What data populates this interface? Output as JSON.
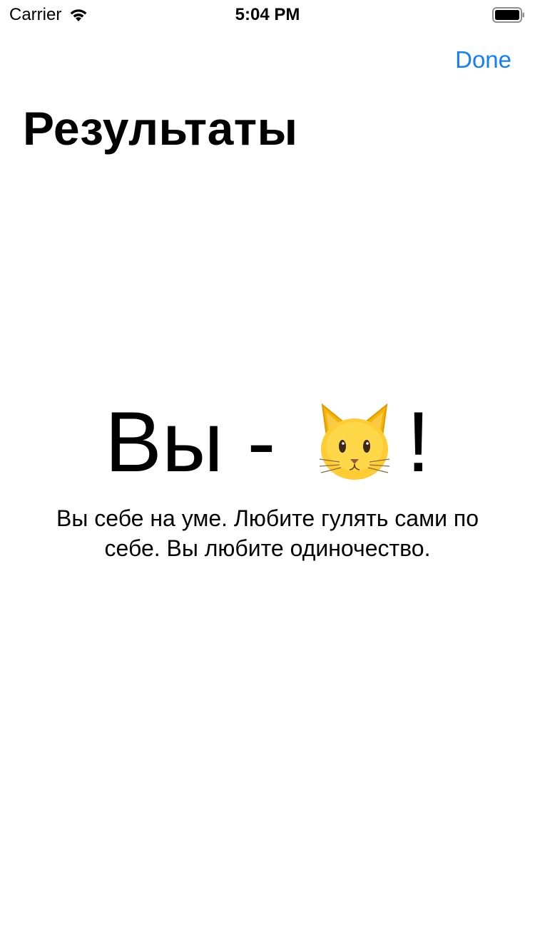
{
  "status_bar": {
    "carrier": "Carrier",
    "time": "5:04 PM",
    "wifi_icon": "wifi-icon",
    "battery_icon": "battery-icon"
  },
  "nav": {
    "done_label": "Done",
    "title": "Результаты",
    "accent_color": "#147efb"
  },
  "result": {
    "prefix": "Вы - ",
    "emoji_icon": "cat-face-icon",
    "suffix": "!",
    "description": "Вы себе на уме. Любите гулять сами по себе. Вы любите одиночество."
  }
}
